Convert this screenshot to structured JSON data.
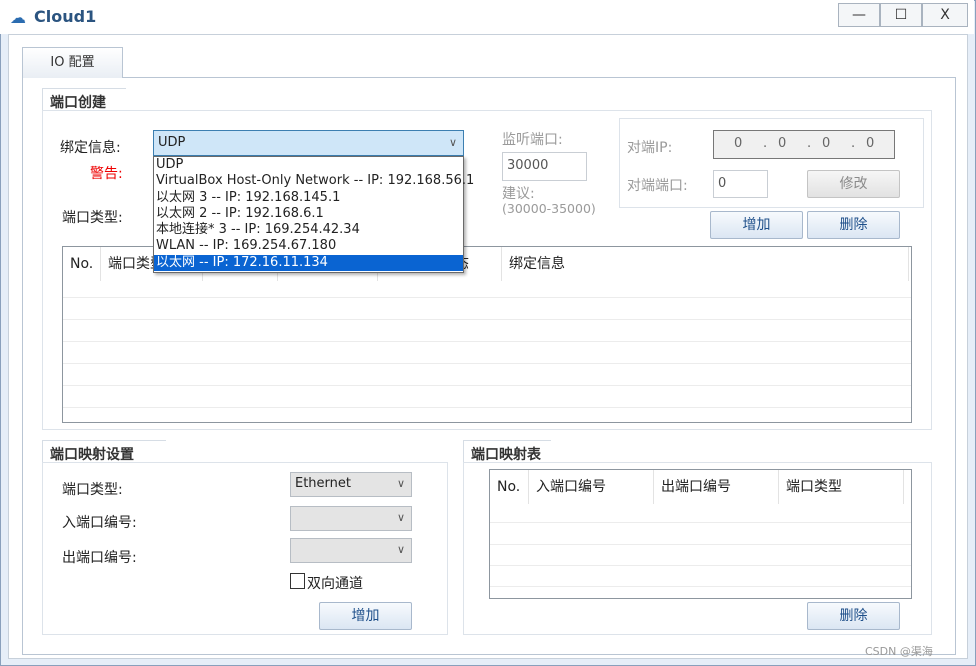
{
  "window": {
    "title": "Cloud1",
    "minimize": "—",
    "maximize": "☐",
    "close": "X"
  },
  "tabs": [
    {
      "label": "IO 配置",
      "active": true
    }
  ],
  "port_create": {
    "group_title": "端口创建",
    "bind_label": "绑定信息:",
    "bind_value": "UDP",
    "bind_options": [
      "UDP",
      "VirtualBox Host-Only Network -- IP: 192.168.56.1",
      "以太网 3 -- IP: 192.168.145.1",
      "以太网 2 -- IP: 192.168.6.1",
      "本地连接* 3 -- IP: 169.254.42.34",
      "WLAN -- IP: 169.254.67.180",
      "以太网 -- IP: 172.16.11.134"
    ],
    "highlighted_option": 6,
    "warning_label": "警告:",
    "port_type_label": "端口类型:",
    "listen_port_label": "监听端口:",
    "listen_port_value": "30000",
    "suggest_label": "建议:",
    "suggest_range": "(30000-35000)",
    "peer_ip_label": "对端IP:",
    "peer_ip": [
      "0",
      "0",
      "0",
      "0"
    ],
    "peer_port_label": "对端端口:",
    "peer_port_value": "0",
    "modify_button": "修改",
    "add_button": "增加",
    "delete_button": "删除",
    "table_headers": [
      "No.",
      "端口类型",
      "",
      "",
      "端口开放状态",
      "绑定信息"
    ]
  },
  "mapping_settings": {
    "group_title": "端口映射设置",
    "port_type_label": "端口类型:",
    "port_type_value": "Ethernet",
    "in_port_label": "入端口编号:",
    "in_port_value": "",
    "out_port_label": "出端口编号:",
    "out_port_value": "",
    "bidirectional_label": "双向通道",
    "bidirectional_checked": false,
    "add_button": "增加"
  },
  "mapping_table": {
    "group_title": "端口映射表",
    "headers": [
      "No.",
      "入端口编号",
      "出端口编号",
      "端口类型"
    ],
    "delete_button": "删除"
  },
  "watermark": "CSDN @渠海"
}
